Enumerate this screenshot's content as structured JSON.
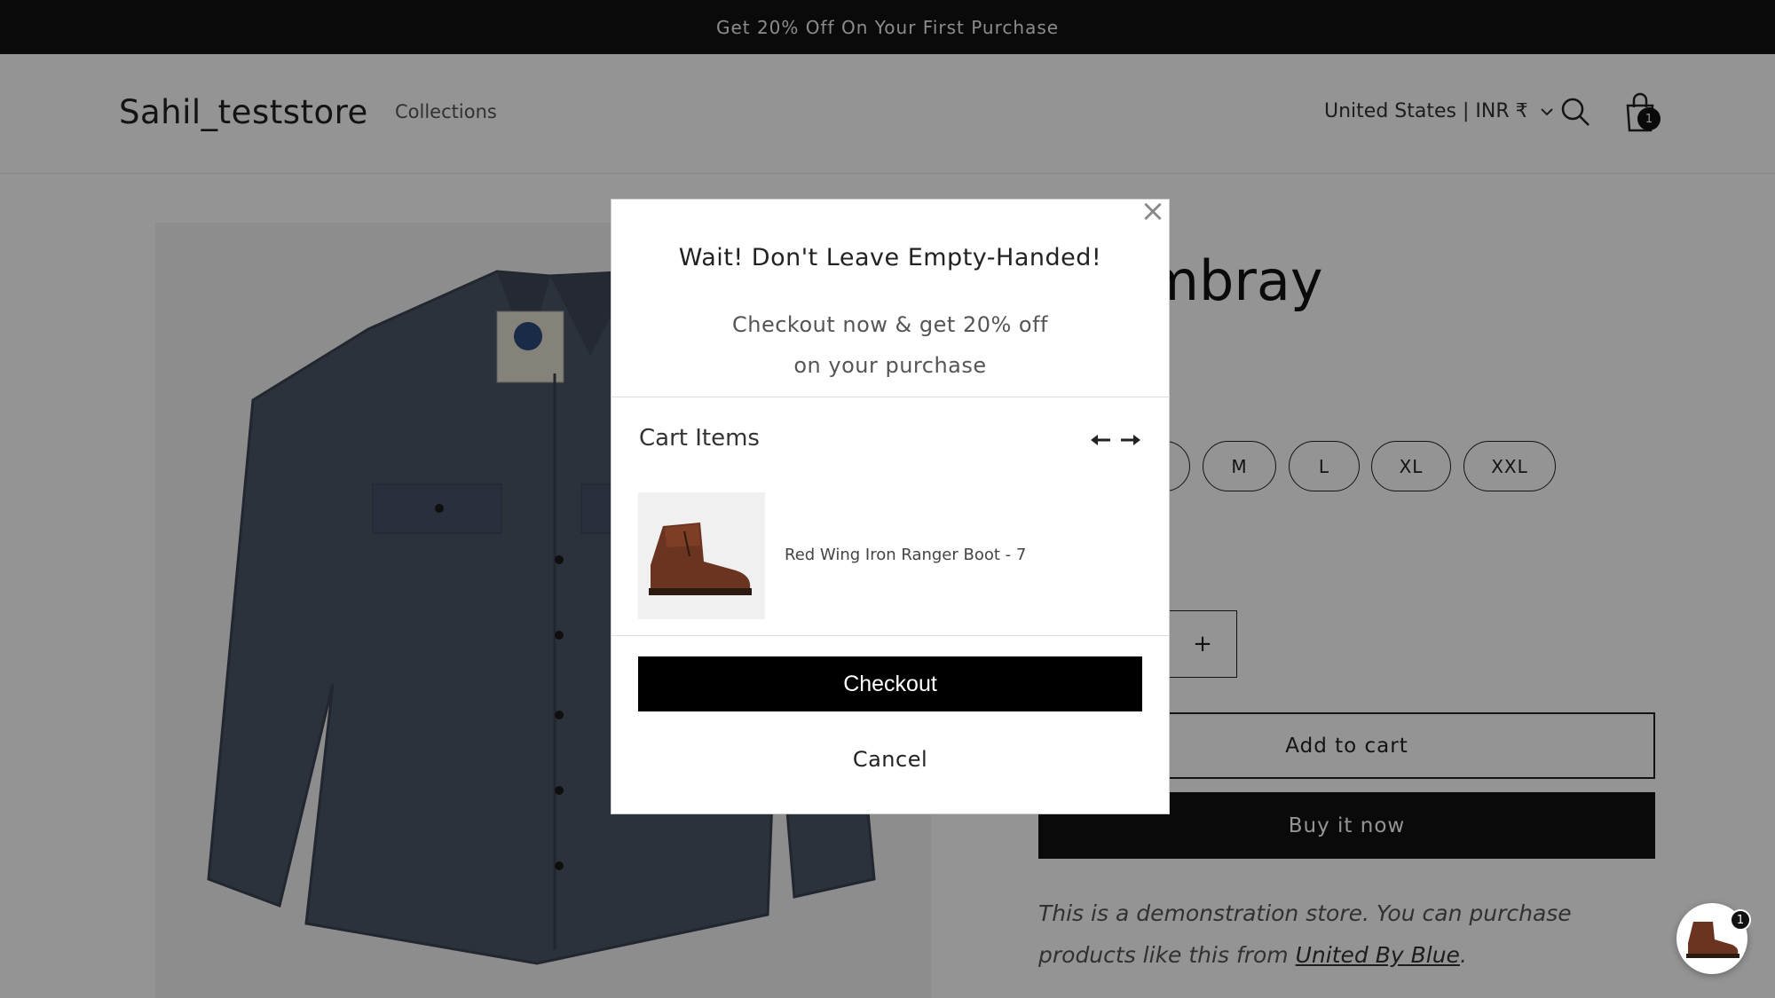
{
  "announcement": {
    "text": "Get 20% Off On Your First Purchase"
  },
  "header": {
    "logo": "Sahil_teststore",
    "nav": [
      "Collections"
    ],
    "locale": "United States | INR ₹",
    "cart_count": "1"
  },
  "product": {
    "title": "Chambray",
    "sizes": [
      "M",
      "L",
      "XL",
      "XXL"
    ],
    "qty_plus": "+",
    "add_to_cart": "Add to cart",
    "buy_now": "Buy it now",
    "description_prefix": "This is a demonstration store. You can purchase products like this from ",
    "description_link": "United By Blue",
    "description_suffix": "."
  },
  "modal": {
    "close": "×",
    "title": "Wait! Don't Leave Empty-Handed!",
    "subtitle_line1": "Checkout now & get 20% off",
    "subtitle_line2": "on your purchase",
    "cart_items_label": "Cart Items",
    "items": [
      {
        "name": "Red Wing Iron Ranger Boot - 7"
      }
    ],
    "checkout_label": "Checkout",
    "cancel_label": "Cancel"
  },
  "chat_widget": {
    "badge": "1"
  },
  "colors": {
    "dark": "#121212",
    "overlay": "rgba(0,0,0,0.42)",
    "shirt": "#4a5566",
    "boot": "#6b3420"
  },
  "icons": [
    "search-icon",
    "cart-icon",
    "chevron-down-icon",
    "close-icon",
    "arrow-left-icon",
    "arrow-right-icon"
  ]
}
